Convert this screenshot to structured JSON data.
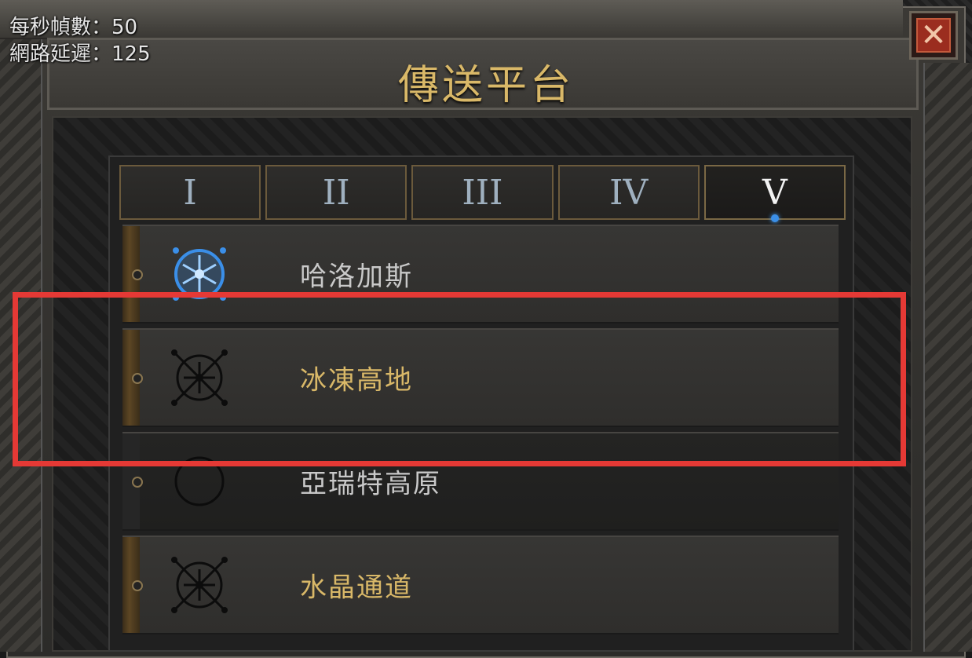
{
  "hud": {
    "fps": "每秒幀數：50",
    "latency": "網路延遲：125"
  },
  "window": {
    "title": "傳送平台",
    "close_glyph": "✕"
  },
  "tabs": [
    {
      "label": "I",
      "active": false
    },
    {
      "label": "II",
      "active": false
    },
    {
      "label": "III",
      "active": false
    },
    {
      "label": "IV",
      "active": false
    },
    {
      "label": "V",
      "active": true
    }
  ],
  "waypoints": [
    {
      "name": "哈洛加斯",
      "state": "current",
      "icon": "waypoint-active-icon"
    },
    {
      "name": "冰凍高地",
      "state": "available",
      "icon": "waypoint-icon"
    },
    {
      "name": "亞瑞特高原",
      "state": "locked",
      "icon": "waypoint-empty-icon"
    },
    {
      "name": "水晶通道",
      "state": "available",
      "icon": "waypoint-icon"
    }
  ],
  "colors": {
    "title": "#d9b868",
    "active_icon": "#3b8fe8",
    "highlight": "#e53935"
  }
}
